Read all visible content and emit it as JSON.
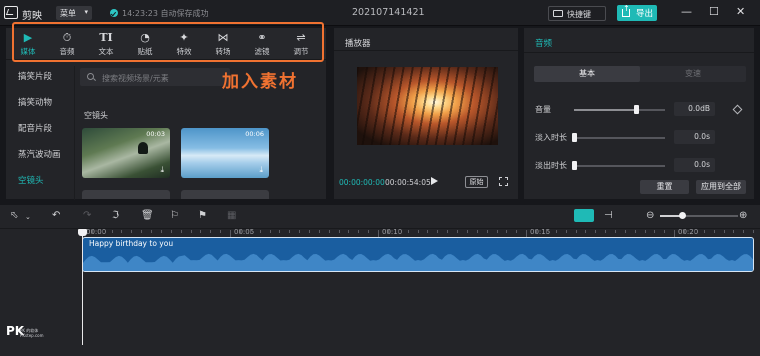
{
  "topbar": {
    "app_name": "剪映",
    "menu_label": "菜单",
    "save_status": "14:23:23 自动保存成功",
    "project_name": "202107141421",
    "shortcut_label": "快捷键",
    "export_label": "导出"
  },
  "toolbar": {
    "tools": [
      {
        "label": "媒体",
        "icon": "media-icon",
        "active": true
      },
      {
        "label": "音频",
        "icon": "audio-icon",
        "active": false
      },
      {
        "label": "文本",
        "icon": "text-icon",
        "active": false
      },
      {
        "label": "贴纸",
        "icon": "sticker-icon",
        "active": false
      },
      {
        "label": "特效",
        "icon": "effects-icon",
        "active": false
      },
      {
        "label": "转场",
        "icon": "transition-icon",
        "active": false
      },
      {
        "label": "滤镜",
        "icon": "filter-icon",
        "active": false
      },
      {
        "label": "调节",
        "icon": "adjust-icon",
        "active": false
      }
    ]
  },
  "annotation": "加入素材",
  "library": {
    "categories": [
      "搞笑片段",
      "搞笑动物",
      "配音片段",
      "蒸汽波动画",
      "空镜头"
    ],
    "active_category": "空镜头",
    "search_placeholder": "搜索视频场景/元素",
    "section_title": "空镜头",
    "clips": [
      {
        "duration": "00:03"
      },
      {
        "duration": "00:06"
      }
    ]
  },
  "player": {
    "title": "播放器",
    "current_time": "00:00:00:00",
    "total_time": "00:00:54:05",
    "original_label": "原始"
  },
  "audio_panel": {
    "title": "音频",
    "tabs": [
      "基本",
      "变速"
    ],
    "active_tab": "基本",
    "rows": [
      {
        "label": "音量",
        "value": "0.0dB",
        "level": 0.69
      },
      {
        "label": "淡入时长",
        "value": "0.0s",
        "level": 0
      },
      {
        "label": "淡出时长",
        "value": "0.0s",
        "level": 0
      }
    ],
    "reset_label": "重置",
    "apply_all_label": "应用到全部"
  },
  "timeline": {
    "ruler": [
      "00:00",
      "00:05",
      "00:10",
      "00:15",
      "00:20"
    ],
    "clip_name": "Happy birthday to you",
    "zoom_level": 0.27
  },
  "watermark": {
    "logo": "PK",
    "caption": "PK 的软体 PKstep.com"
  },
  "colors": {
    "accent": "#1fbab6",
    "highlight": "#f07231",
    "audio_clip": "#1a5ea0"
  }
}
